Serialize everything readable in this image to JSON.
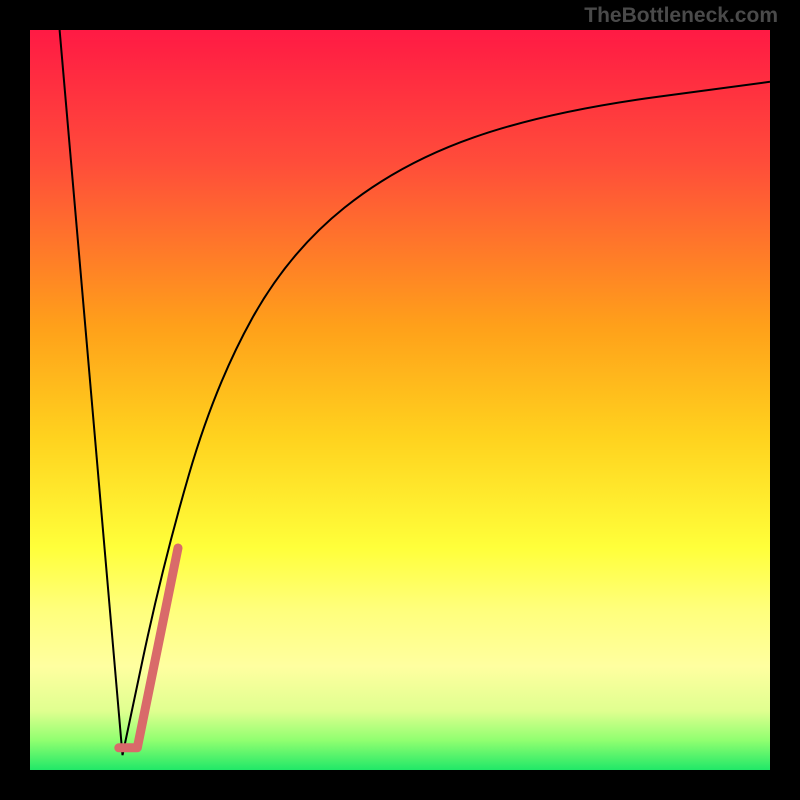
{
  "watermark": "TheBottleneck.com",
  "chart_data": {
    "type": "line",
    "title": "",
    "xlabel": "",
    "ylabel": "",
    "xlim": [
      0,
      100
    ],
    "ylim": [
      0,
      100
    ],
    "gradient_stops": [
      {
        "offset": 0,
        "color": "#ff1a44"
      },
      {
        "offset": 18,
        "color": "#ff4d3a"
      },
      {
        "offset": 40,
        "color": "#ffa01a"
      },
      {
        "offset": 55,
        "color": "#ffd21e"
      },
      {
        "offset": 70,
        "color": "#ffff3a"
      },
      {
        "offset": 78,
        "color": "#ffff7a"
      },
      {
        "offset": 86,
        "color": "#ffffa0"
      },
      {
        "offset": 92,
        "color": "#e0ff90"
      },
      {
        "offset": 96,
        "color": "#90ff70"
      },
      {
        "offset": 100,
        "color": "#20e868"
      }
    ],
    "series": [
      {
        "name": "left-descent",
        "type": "line",
        "color": "#000000",
        "width": 2,
        "points": [
          {
            "x": 4,
            "y": 100
          },
          {
            "x": 12.5,
            "y": 2
          }
        ]
      },
      {
        "name": "right-curve",
        "type": "curve",
        "color": "#000000",
        "width": 2,
        "points": [
          {
            "x": 12.5,
            "y": 2
          },
          {
            "x": 18,
            "y": 28
          },
          {
            "x": 25,
            "y": 52
          },
          {
            "x": 35,
            "y": 70
          },
          {
            "x": 50,
            "y": 82
          },
          {
            "x": 70,
            "y": 89
          },
          {
            "x": 100,
            "y": 93
          }
        ]
      },
      {
        "name": "highlight-segment",
        "type": "line",
        "color": "#d96a6a",
        "width": 9,
        "points": [
          {
            "x": 12,
            "y": 3
          },
          {
            "x": 14.5,
            "y": 3
          },
          {
            "x": 20,
            "y": 30
          }
        ]
      }
    ]
  }
}
